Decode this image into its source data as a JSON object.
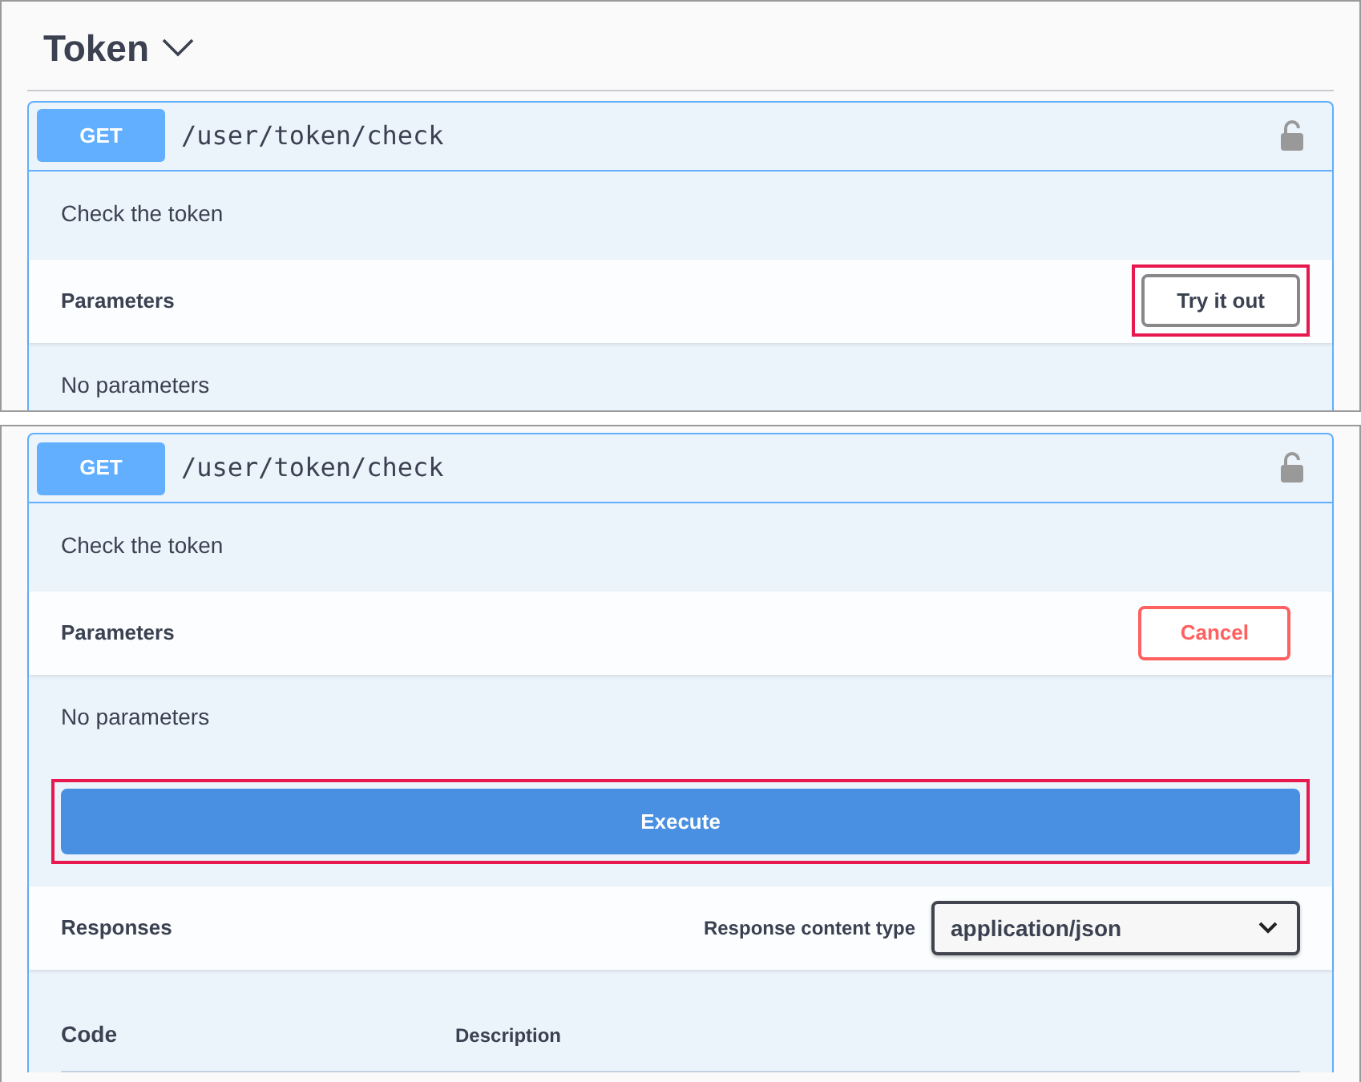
{
  "panels": [
    {
      "section": {
        "title": "Token",
        "expanded": true
      },
      "operation": {
        "method": "GET",
        "path": "/user/token/check",
        "locked": false
      },
      "description": "Check the token",
      "parameters": {
        "label": "Parameters",
        "button": {
          "label": "Try it out",
          "kind": "try",
          "highlighted": true
        },
        "empty_text": "No parameters"
      }
    },
    {
      "operation": {
        "method": "GET",
        "path": "/user/token/check",
        "locked": false
      },
      "description": "Check the token",
      "parameters": {
        "label": "Parameters",
        "button": {
          "label": "Cancel",
          "kind": "cancel",
          "highlighted": false
        },
        "empty_text": "No parameters"
      },
      "execute": {
        "label": "Execute",
        "highlighted": true
      },
      "responses": {
        "label": "Responses",
        "content_type_label": "Response content type",
        "content_type": "application/json",
        "columns": [
          "Code",
          "Description"
        ]
      }
    }
  ]
}
